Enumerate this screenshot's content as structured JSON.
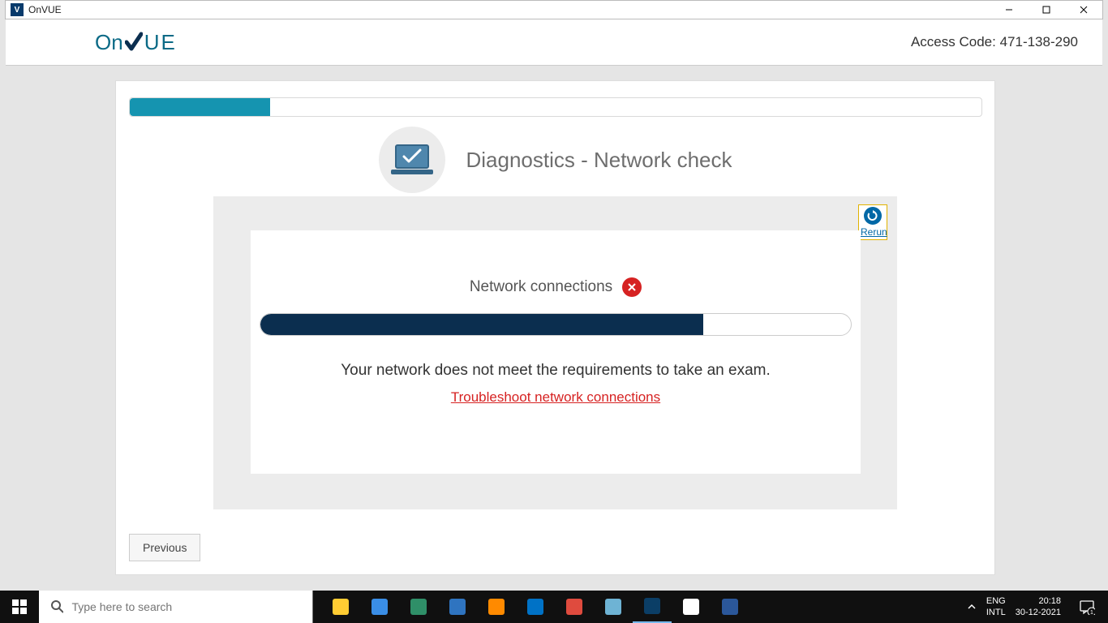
{
  "window": {
    "title": "OnVUE",
    "app_icon_letter": "V"
  },
  "header": {
    "logo_on": "On",
    "logo_ue": "UE",
    "access_label": "Access Code:",
    "access_code": "471-138-290"
  },
  "diagnostics": {
    "title": "Diagnostics - Network check",
    "overall_progress_percent": 16.5,
    "rerun_label": "Rerun",
    "network_label": "Network connections",
    "network_status": "fail",
    "network_progress_percent": 75,
    "fail_message": "Your network does not meet the requirements to take an exam.",
    "troubleshoot_link": "Troubleshoot network connections",
    "previous_button": "Previous"
  },
  "taskbar": {
    "search_placeholder": "Type here to search",
    "lang_line1": "ENG",
    "lang_line2": "INTL",
    "time": "20:18",
    "date": "30-12-2021",
    "notification_count": "1",
    "apps": [
      {
        "name": "file-explorer",
        "color": "#ffcc33"
      },
      {
        "name": "microsoft-store",
        "color": "#3a8ee6"
      },
      {
        "name": "edge",
        "color": "#2f8f68"
      },
      {
        "name": "internet-explorer",
        "color": "#2f74c0"
      },
      {
        "name": "firefox",
        "color": "#ff8a00"
      },
      {
        "name": "outlook",
        "color": "#0072c6"
      },
      {
        "name": "chrome",
        "color": "#df4b3e"
      },
      {
        "name": "task-manager",
        "color": "#6eb3d4"
      },
      {
        "name": "onvue-app",
        "color": "#0b3e66",
        "active": true
      },
      {
        "name": "windows-security",
        "color": "#ffffff"
      },
      {
        "name": "word",
        "color": "#2b579a"
      }
    ]
  }
}
